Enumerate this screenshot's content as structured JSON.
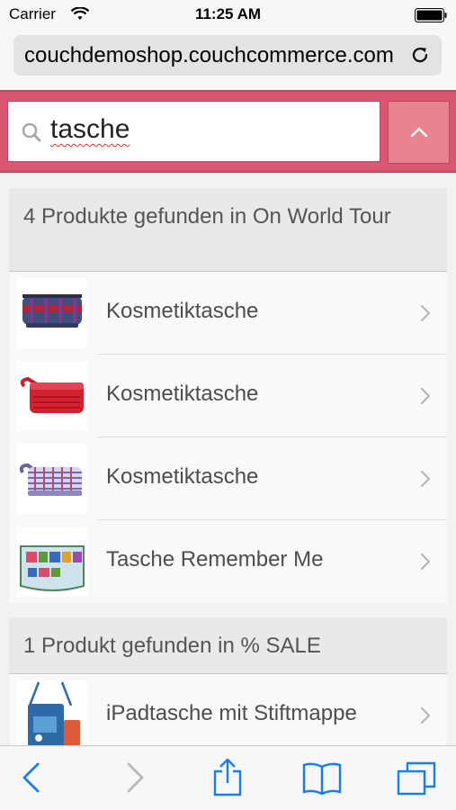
{
  "status_bar": {
    "carrier": "Carrier",
    "time": "11:25 AM"
  },
  "browser": {
    "url": "couchdemoshop.couchcommerce.com"
  },
  "search": {
    "value": "tasche"
  },
  "groups": [
    {
      "header": "4 Produkte gefunden in On World Tour",
      "items": [
        {
          "label": "Kosmetiktasche",
          "thumb": "blue-cosmetic-bag"
        },
        {
          "label": "Kosmetiktasche",
          "thumb": "red-cosmetic-bag"
        },
        {
          "label": "Kosmetiktasche",
          "thumb": "checkered-cosmetic-bag"
        },
        {
          "label": "Tasche Remember Me",
          "thumb": "remember-me-bag"
        }
      ]
    },
    {
      "header": "1 Produkt gefunden in % SALE",
      "items": [
        {
          "label": "iPadtasche mit Stiftmappe",
          "thumb": "ipad-bag"
        }
      ]
    }
  ],
  "colors": {
    "accent": "#d95770",
    "ios_blue": "#1a7cf5"
  }
}
